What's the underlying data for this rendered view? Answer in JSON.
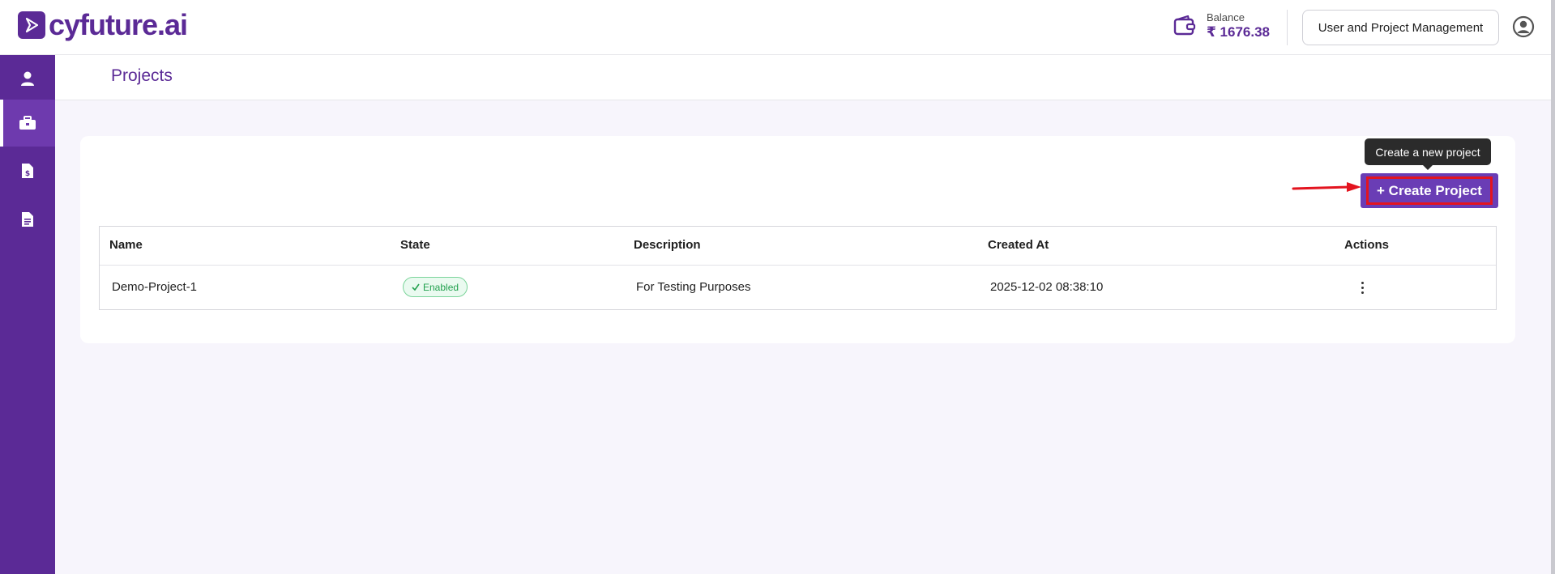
{
  "header": {
    "logo_text": "cyfuture.ai",
    "balance_label": "Balance",
    "balance_value": "₹ 1676.38",
    "user_project_btn": "User and Project Management"
  },
  "sidebar": {
    "items": [
      {
        "icon": "user-icon",
        "active": false
      },
      {
        "icon": "briefcase-icon",
        "active": true
      },
      {
        "icon": "billing-document-icon",
        "active": false
      },
      {
        "icon": "document-icon",
        "active": false
      }
    ]
  },
  "page": {
    "title": "Projects"
  },
  "toolbar": {
    "tooltip": "Create a new project",
    "create_label": "+ Create Project"
  },
  "table": {
    "headers": [
      "Name",
      "State",
      "Description",
      "Created At",
      "Actions"
    ],
    "rows": [
      {
        "name": "Demo-Project-1",
        "state": "Enabled",
        "description": "For Testing Purposes",
        "created_at": "2025-12-02 08:38:10"
      }
    ]
  },
  "colors": {
    "brand": "#5b2a96",
    "button": "#6a3db5",
    "highlight": "#e3141f",
    "enabled": "#23a14f"
  }
}
